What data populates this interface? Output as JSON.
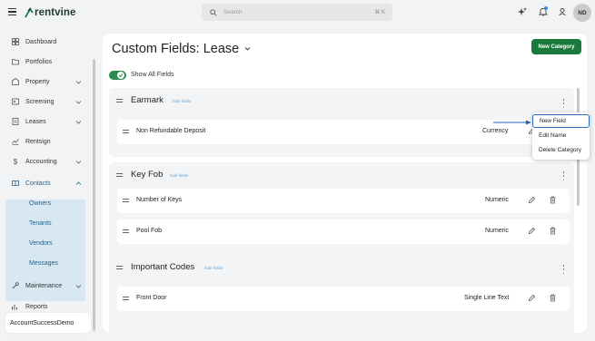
{
  "app": {
    "logo_text": "rentvine"
  },
  "search": {
    "placeholder": "Search",
    "shortcut": "⌘ K"
  },
  "user": {
    "initials": "ND"
  },
  "sidebar": {
    "items": [
      {
        "label": "Dashboard",
        "icon": "dashboard-icon"
      },
      {
        "label": "Portfolios",
        "icon": "folder-icon"
      },
      {
        "label": "Property",
        "icon": "property-icon"
      },
      {
        "label": "Screening",
        "icon": "screening-icon"
      },
      {
        "label": "Leases",
        "icon": "lease-icon"
      },
      {
        "label": "Rentsign",
        "icon": "rentsign-icon"
      },
      {
        "label": "Accounting",
        "icon": "dollar-icon"
      },
      {
        "label": "Contacts",
        "icon": "book-icon"
      },
      {
        "label": "Maintenance",
        "icon": "wrench-icon"
      },
      {
        "label": "Reports",
        "icon": "chart-icon"
      }
    ],
    "contacts_sub": [
      "Owners",
      "Tenants",
      "Vendors",
      "Messages"
    ],
    "account": "AccountSuccessDemo"
  },
  "main": {
    "title": "Custom Fields: Lease",
    "new_category_label": "New Category",
    "show_all_label": "Show All Fields",
    "hide_fields_label": "hide fields",
    "categories": [
      {
        "title": "Earmark",
        "fields": [
          {
            "name": "Non Refundable Deposit",
            "type": "Currency"
          }
        ]
      },
      {
        "title": "Key Fob",
        "fields": [
          {
            "name": "Number of Keys",
            "type": "Numeric"
          },
          {
            "name": "Pool Fob",
            "type": "Numeric"
          }
        ]
      },
      {
        "title": "Important Codes",
        "fields": [
          {
            "name": "Front Door",
            "type": "Single Line Text"
          }
        ]
      }
    ]
  },
  "dropdown": {
    "items": [
      "New Field",
      "Edit Name",
      "Delete Category"
    ],
    "active": "New Field"
  },
  "colors": {
    "brand_green": "#1a7a3c",
    "contacts_bg": "#d8e8f3",
    "link_blue": "#6aa8d6"
  }
}
